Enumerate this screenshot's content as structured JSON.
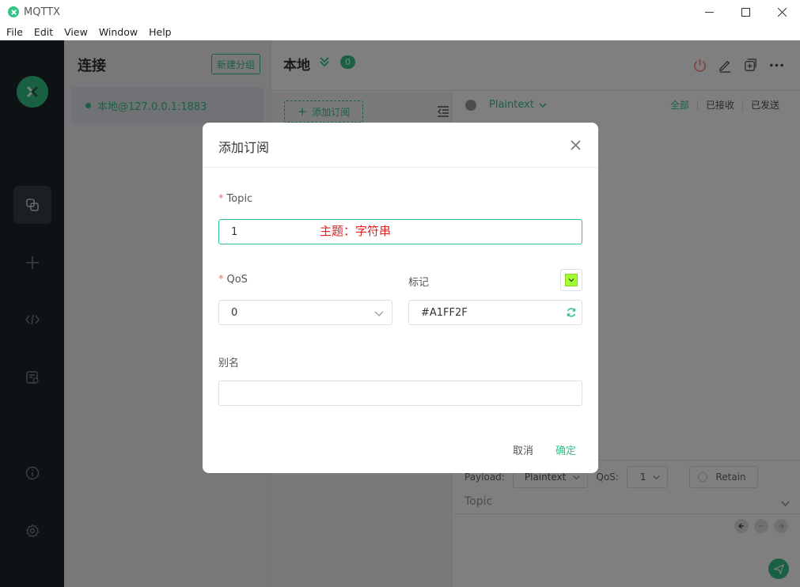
{
  "window": {
    "title": "MQTTX"
  },
  "menu": [
    "File",
    "Edit",
    "View",
    "Window",
    "Help"
  ],
  "connections": {
    "title": "连接",
    "new_group_label": "新建分组",
    "items": [
      {
        "name": "本地@127.0.0.1:1883",
        "status": "connected"
      }
    ]
  },
  "main": {
    "title": "本地",
    "subscription_count": "0",
    "add_subscription_label": "添加订阅",
    "payload_format": "Plaintext",
    "filters": [
      "全部",
      "已接收",
      "已发送"
    ],
    "compose": {
      "payload_label": "Payload:",
      "payload_format": "Plaintext",
      "qos_label": "QoS:",
      "qos_value": "1",
      "retain_label": "Retain",
      "topic_placeholder": "Topic"
    }
  },
  "dialog": {
    "title": "添加订阅",
    "topic_label": "Topic",
    "topic_value": "1",
    "topic_hint": "主题：字符串",
    "qos_label": "QoS",
    "qos_value": "0",
    "mark_label": "标记",
    "color_value": "#A1FF2F",
    "alias_label": "别名",
    "alias_value": "",
    "cancel_label": "取消",
    "confirm_label": "确定"
  },
  "colors": {
    "accent": "#34c388",
    "sidebar": "#1f2528",
    "tag_color": "#A1FF2F",
    "required": "#f56c6c",
    "hint": "#e02020"
  }
}
